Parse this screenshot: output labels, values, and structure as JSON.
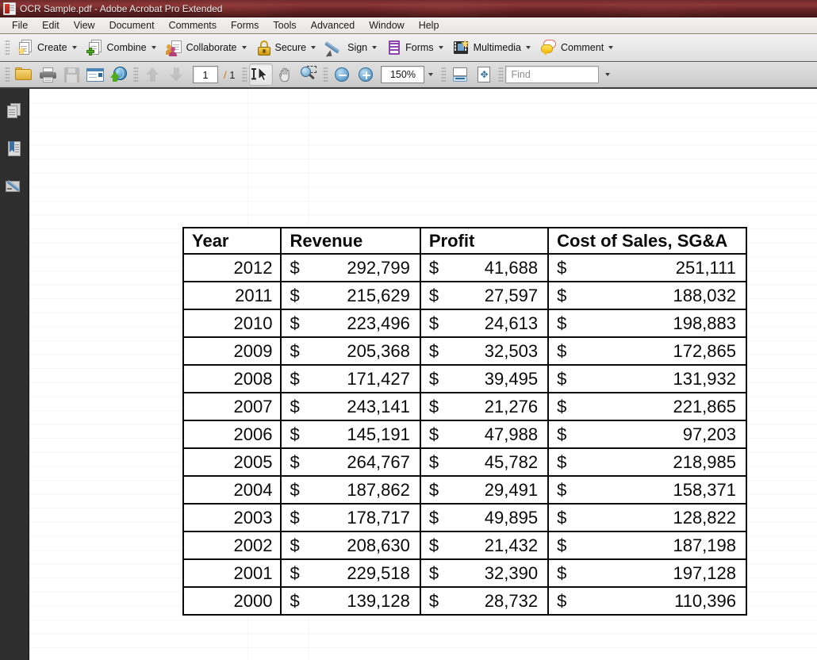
{
  "window": {
    "title": "OCR Sample.pdf - Adobe Acrobat Pro Extended",
    "app_icon": "acrobat-pdf-icon",
    "titlebar_color": "#7c2f2f"
  },
  "menubar": {
    "items": [
      {
        "label": "File"
      },
      {
        "label": "Edit"
      },
      {
        "label": "View"
      },
      {
        "label": "Document"
      },
      {
        "label": "Comments"
      },
      {
        "label": "Forms"
      },
      {
        "label": "Tools"
      },
      {
        "label": "Advanced"
      },
      {
        "label": "Window"
      },
      {
        "label": "Help"
      }
    ]
  },
  "tasks_toolbar": {
    "items": [
      {
        "label": "Create",
        "icon": "create-pdf-icon",
        "has_dropdown": true
      },
      {
        "label": "Combine",
        "icon": "combine-files-icon",
        "has_dropdown": true
      },
      {
        "label": "Collaborate",
        "icon": "collaborate-icon",
        "has_dropdown": true
      },
      {
        "label": "Secure",
        "icon": "lock-icon",
        "has_dropdown": true
      },
      {
        "label": "Sign",
        "icon": "pen-icon",
        "has_dropdown": true
      },
      {
        "label": "Forms",
        "icon": "forms-icon",
        "has_dropdown": true
      },
      {
        "label": "Multimedia",
        "icon": "multimedia-film-icon",
        "has_dropdown": true
      },
      {
        "label": "Comment",
        "icon": "comment-bubble-icon",
        "has_dropdown": true
      }
    ]
  },
  "file_toolbar": {
    "open_icon": "open-folder-icon",
    "print_icon": "print-icon",
    "save_icon": "save-disk-icon",
    "email_icon": "email-icon",
    "upload_icon": "globe-upload-icon",
    "prev_page_icon": "arrow-up-icon",
    "next_page_icon": "arrow-down-icon",
    "page_number": "1",
    "page_separator": "/",
    "page_total": "1",
    "select_tool_icon": "select-text-icon",
    "hand_tool_icon": "hand-icon",
    "marquee_zoom_icon": "marquee-zoom-icon",
    "zoom_out_icon": "zoom-out-icon",
    "zoom_in_icon": "zoom-in-icon",
    "zoom_value": "150%",
    "fit_width_icon": "fit-width-icon",
    "fit_page_icon": "fit-page-icon",
    "find_placeholder": "Find",
    "find_value": ""
  },
  "nav_rail": {
    "items": [
      {
        "name": "page-thumbnails",
        "icon": "pages-icon"
      },
      {
        "name": "bookmarks",
        "icon": "bookmark-icon"
      },
      {
        "name": "signatures",
        "icon": "signature-icon"
      }
    ]
  },
  "document": {
    "table": {
      "headers": [
        "Year",
        "Revenue",
        "Profit",
        "Cost of Sales, SG&A"
      ],
      "currency_symbol": "$",
      "rows": [
        {
          "year": "2012",
          "revenue": "292,799",
          "profit": "41,688",
          "cost": "251,111"
        },
        {
          "year": "2011",
          "revenue": "215,629",
          "profit": "27,597",
          "cost": "188,032"
        },
        {
          "year": "2010",
          "revenue": "223,496",
          "profit": "24,613",
          "cost": "198,883"
        },
        {
          "year": "2009",
          "revenue": "205,368",
          "profit": "32,503",
          "cost": "172,865"
        },
        {
          "year": "2008",
          "revenue": "171,427",
          "profit": "39,495",
          "cost": "131,932"
        },
        {
          "year": "2007",
          "revenue": "243,141",
          "profit": "21,276",
          "cost": "221,865"
        },
        {
          "year": "2006",
          "revenue": "145,191",
          "profit": "47,988",
          "cost": "97,203"
        },
        {
          "year": "2005",
          "revenue": "264,767",
          "profit": "45,782",
          "cost": "218,985"
        },
        {
          "year": "2004",
          "revenue": "187,862",
          "profit": "29,491",
          "cost": "158,371"
        },
        {
          "year": "2003",
          "revenue": "178,717",
          "profit": "49,895",
          "cost": "128,822"
        },
        {
          "year": "2002",
          "revenue": "208,630",
          "profit": "21,432",
          "cost": "187,198"
        },
        {
          "year": "2001",
          "revenue": "229,518",
          "profit": "32,390",
          "cost": "197,128"
        },
        {
          "year": "2000",
          "revenue": "139,128",
          "profit": "28,732",
          "cost": "110,396"
        }
      ]
    }
  }
}
